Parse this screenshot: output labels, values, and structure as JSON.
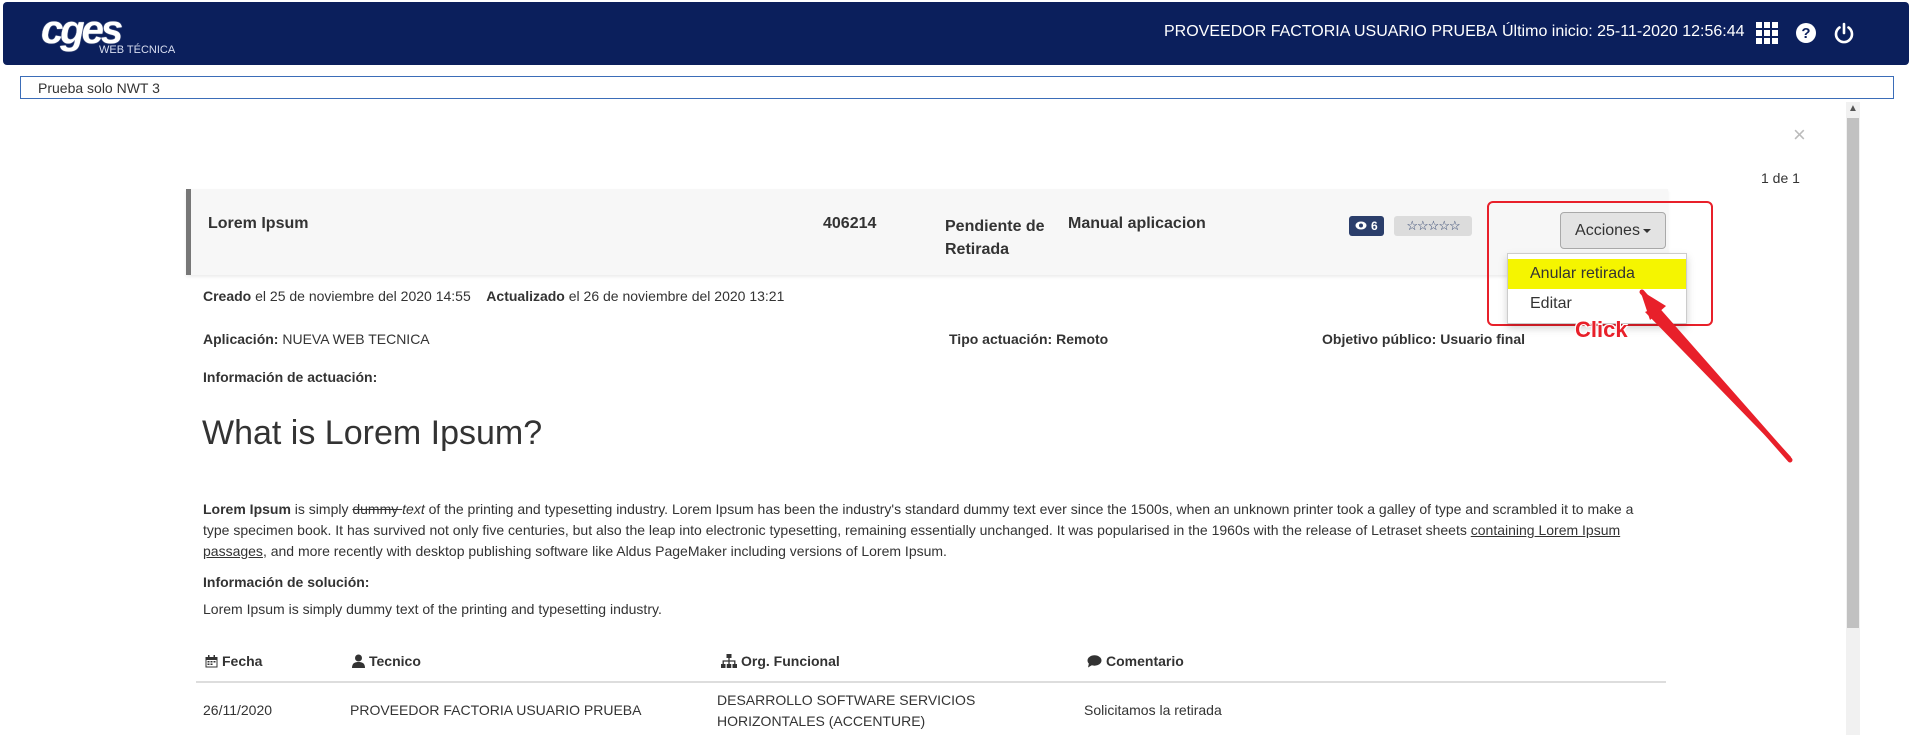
{
  "header": {
    "logo_text": "cges",
    "logo_sub": "WEB TÉCNICA",
    "user_name": "PROVEEDOR FACTORIA USUARIO PRUEBA",
    "last_login": "Último inicio: 25-11-2020 12:56:44",
    "icons": [
      "apps-grid-icon",
      "help-icon",
      "power-icon"
    ]
  },
  "subbar": {
    "label": "Prueba solo NWT 3"
  },
  "panel": {
    "close_glyph": "×",
    "pager": "1 de 1"
  },
  "record": {
    "title": "Lorem Ipsum",
    "id": "406214",
    "status": "Pendiente de Retirada",
    "type": "Manual aplicacion",
    "views": "6",
    "stars": "☆☆☆☆☆"
  },
  "actions": {
    "button_label": "Acciones",
    "menu_items": [
      "Anular retirada",
      "Editar"
    ],
    "annotation": "Click"
  },
  "meta": {
    "created_label": "Creado",
    "created_value": " el 25 de noviembre del 2020 14:55",
    "updated_label": "Actualizado",
    "updated_value": " el 26 de noviembre del 2020 13:21",
    "app_label": "Aplicación:",
    "app_value": " NUEVA WEB TECNICA",
    "tipo_label": "Tipo actuación:",
    "tipo_value": " Remoto",
    "objetivo_label": "Objetivo público:",
    "objetivo_value": " Usuario final",
    "info_actuacion": "Información de actuación:"
  },
  "article": {
    "heading": "What is Lorem Ipsum?",
    "bold_lead": "Lorem Ipsum",
    "p1": " is simply ",
    "strike": "dummy ",
    "italic": "text",
    "p2": " of the printing and typesetting industry. Lorem Ipsum has been the industry's standard dummy text ever since the 1500s, when an unknown printer took a galley of type and scrambled it to make a type specimen book. It has survived not only five centuries, but also the leap into electronic typesetting, remaining essentially unchanged. It was popularised in the 1960s with the release of Letraset sheets ",
    "link": "containing Lorem Ipsum passages",
    "p3": ", and more recently with desktop publishing software like Aldus PageMaker including versions of Lorem Ipsum.",
    "info_solucion": "Información de solución:",
    "solucion_text": "Lorem Ipsum is simply dummy text of the printing and typesetting industry."
  },
  "table": {
    "columns": [
      "Fecha",
      "Tecnico",
      "Org. Funcional",
      "Comentario"
    ],
    "rows": [
      {
        "fecha": "26/11/2020",
        "tecnico": "PROVEEDOR FACTORIA USUARIO PRUEBA",
        "org": "DESARROLLO SOFTWARE SERVICIOS HORIZONTALES (ACCENTURE)",
        "comentario": "Solicitamos la retirada"
      }
    ]
  },
  "colors": {
    "header_bg": "#0b1f5c",
    "highlight": "#f5f500",
    "annotation_red": "#e8202a"
  }
}
